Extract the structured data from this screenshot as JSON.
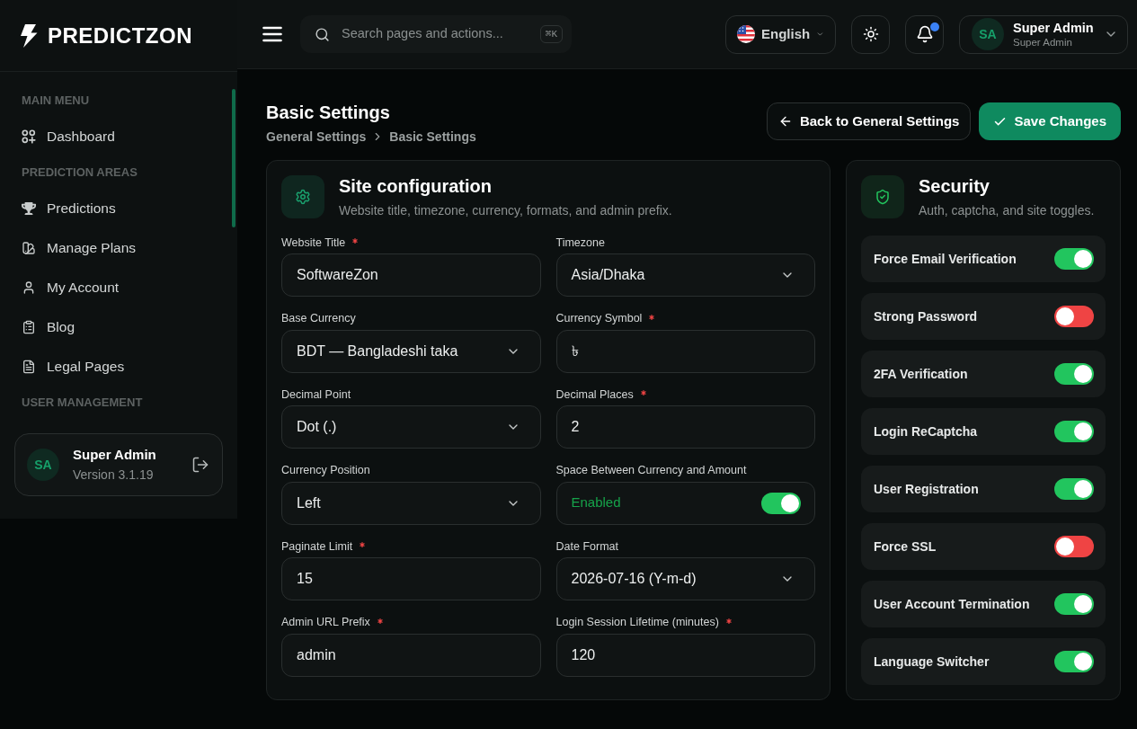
{
  "sidebar": {
    "logo": "PREDICTZON",
    "sections": [
      {
        "heading": "MAIN MENU",
        "items": [
          "Dashboard"
        ]
      },
      {
        "heading": "PREDICTION AREAS",
        "items": [
          "Predictions",
          "Manage Plans",
          "My Account",
          "Blog",
          "Legal Pages"
        ]
      },
      {
        "heading": "USER MANAGEMENT"
      }
    ],
    "user_card": {
      "initials": "SA",
      "name": "Super Admin",
      "version": "Version 3.1.19"
    }
  },
  "header": {
    "search": {
      "placeholder": "Search pages and actions...",
      "shortcut": "⌘K"
    },
    "language": "English",
    "notifications": {
      "unread": true
    },
    "user": {
      "initials": "SA",
      "name": "Super Admin",
      "role": "Super Admin"
    }
  },
  "page": {
    "title": "Basic Settings",
    "breadcrumb": [
      "General Settings",
      "Basic Settings"
    ],
    "back_button": "Back to General Settings",
    "save_button": "Save Changes"
  },
  "site_configuration": {
    "title": "Site configuration",
    "subtitle": "Website title, timezone, currency, formats, and admin prefix.",
    "fields": [
      {
        "label": "Website Title",
        "required": true,
        "kind": "text",
        "value": "SoftwareZon"
      },
      {
        "label": "Timezone",
        "required": false,
        "kind": "select",
        "value": "Asia/Dhaka"
      },
      {
        "label": "Base Currency",
        "required": false,
        "kind": "select",
        "value": "BDT — Bangladeshi taka"
      },
      {
        "label": "Currency Symbol",
        "required": true,
        "kind": "text",
        "value": "৳"
      },
      {
        "label": "Decimal Point",
        "required": false,
        "kind": "select",
        "value": "Dot (.)"
      },
      {
        "label": "Decimal Places",
        "required": true,
        "kind": "text",
        "value": "2"
      },
      {
        "label": "Currency Position",
        "required": false,
        "kind": "select",
        "value": "Left"
      },
      {
        "label": "Space Between Currency and Amount",
        "required": false,
        "kind": "toggle",
        "value": "Enabled",
        "on": true
      },
      {
        "label": "Paginate Limit",
        "required": true,
        "kind": "text",
        "value": "15"
      },
      {
        "label": "Date Format",
        "required": false,
        "kind": "select",
        "value": "2026-07-16 (Y-m-d)"
      },
      {
        "label": "Admin URL Prefix",
        "required": true,
        "kind": "text",
        "value": "admin"
      },
      {
        "label": "Login Session Lifetime (minutes)",
        "required": true,
        "kind": "text",
        "value": "120"
      }
    ]
  },
  "security": {
    "title": "Security",
    "subtitle": "Auth, captcha, and site toggles.",
    "toggles": [
      {
        "label": "Force Email Verification",
        "on": true
      },
      {
        "label": "Strong Password",
        "on": false
      },
      {
        "label": "2FA Verification",
        "on": true
      },
      {
        "label": "Login ReCaptcha",
        "on": true
      },
      {
        "label": "User Registration",
        "on": true
      },
      {
        "label": "Force SSL",
        "on": false
      },
      {
        "label": "User Account Termination",
        "on": true
      },
      {
        "label": "Language Switcher",
        "on": true
      }
    ]
  }
}
